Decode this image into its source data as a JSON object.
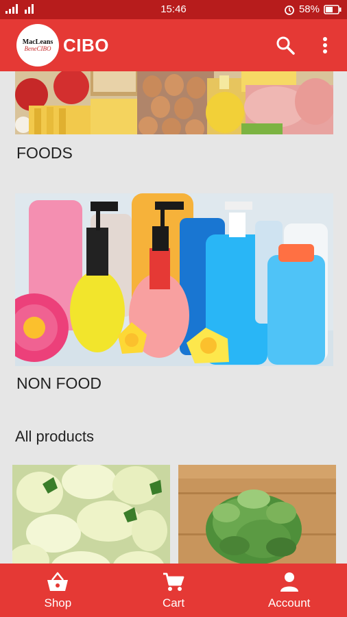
{
  "status_bar": {
    "time": "15:46",
    "battery": "58%",
    "icons": [
      "signal-icon",
      "wifi-icon",
      "alarm-icon",
      "battery-icon"
    ]
  },
  "app_bar": {
    "logo_text_line1": "MacLeans",
    "logo_text_line2": "BeneCIBO",
    "title": "CIBO",
    "icons": [
      "search-icon",
      "more-vert-icon"
    ]
  },
  "categories": [
    {
      "label": "FOODS",
      "image": "foods-photo"
    },
    {
      "label": "NON FOOD",
      "image": "non-food-photo"
    }
  ],
  "all_products": {
    "title": "All products",
    "items": [
      {
        "image": "white-eggplants-photo"
      },
      {
        "image": "artichoke-photo"
      }
    ]
  },
  "bottom_nav": [
    {
      "label": "Shop",
      "icon": "shopping-basket-icon"
    },
    {
      "label": "Cart",
      "icon": "cart-icon"
    },
    {
      "label": "Account",
      "icon": "account-icon"
    }
  ],
  "colors": {
    "primary": "#e53935",
    "status_bar": "#b71c1c",
    "background": "#e6e6e6"
  }
}
